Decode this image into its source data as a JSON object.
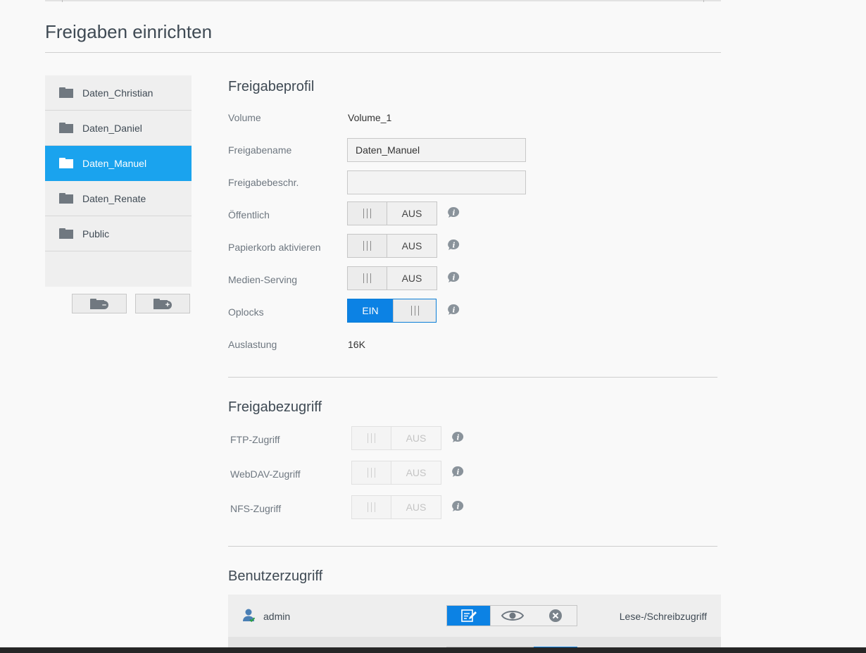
{
  "page": {
    "title": "Freigaben einrichten"
  },
  "shares": {
    "items": [
      {
        "label": "Daten_Christian",
        "active": false
      },
      {
        "label": "Daten_Daniel",
        "active": false
      },
      {
        "label": "Daten_Manuel",
        "active": true
      },
      {
        "label": "Daten_Renate",
        "active": false
      },
      {
        "label": "Public",
        "active": false
      }
    ],
    "remove_icon": "folder-minus-icon",
    "add_icon": "folder-plus-icon"
  },
  "profile": {
    "title": "Freigabeprofil",
    "volume_label": "Volume",
    "volume_value": "Volume_1",
    "name_label": "Freigabename",
    "name_value": "Daten_Manuel",
    "desc_label": "Freigabebeschr.",
    "desc_value": "",
    "public_label": "Öffentlich",
    "public_state": "AUS",
    "recycle_label": "Papierkorb aktivieren",
    "recycle_state": "AUS",
    "media_label": "Medien-Serving",
    "media_state": "AUS",
    "oplocks_label": "Oplocks",
    "oplocks_state": "EIN",
    "usage_label": "Auslastung",
    "usage_value": "16K"
  },
  "access": {
    "title": "Freigabezugriff",
    "ftp_label": "FTP-Zugriff",
    "ftp_state": "AUS",
    "webdav_label": "WebDAV-Zugriff",
    "webdav_state": "AUS",
    "nfs_label": "NFS-Zugriff",
    "nfs_state": "AUS"
  },
  "users": {
    "title": "Benutzerzugriff",
    "rows": [
      {
        "name": "admin",
        "permission": "Lese-/Schreibzugriff"
      }
    ]
  },
  "colors": {
    "accent": "#1aa3ee",
    "toggle_on": "#0c82e4",
    "text": "#3f4a54",
    "icon": "#707880"
  }
}
